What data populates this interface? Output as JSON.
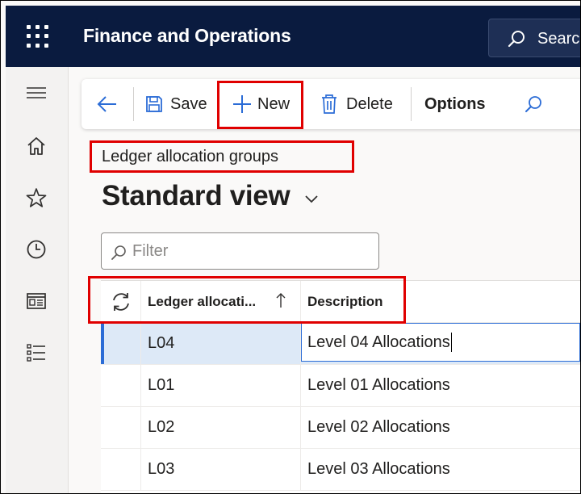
{
  "app": {
    "title": "Finance and Operations"
  },
  "search": {
    "label": "Search"
  },
  "actions": {
    "save": "Save",
    "new": "New",
    "delete": "Delete",
    "options": "Options"
  },
  "breadcrumb": "Ledger allocation groups",
  "view": {
    "title": "Standard view"
  },
  "filter": {
    "placeholder": "Filter"
  },
  "grid": {
    "columns": {
      "id": "Ledger allocati...",
      "description": "Description"
    },
    "rows": [
      {
        "id": "L04",
        "description": "Level 04 Allocations",
        "selected": true
      },
      {
        "id": "L01",
        "description": "Level 01 Allocations",
        "selected": false
      },
      {
        "id": "L02",
        "description": "Level 02 Allocations",
        "selected": false
      },
      {
        "id": "L03",
        "description": "Level 03 Allocations",
        "selected": false
      }
    ]
  },
  "colors": {
    "nav_bg": "#0a1b3f",
    "accent": "#2b6cd6",
    "highlight": "#e00000",
    "selected_row": "#dde9f7"
  },
  "icons": [
    "waffle-icon",
    "search-icon",
    "hamburger-icon",
    "home-icon",
    "star-icon",
    "clock-icon",
    "workspace-icon",
    "modules-icon",
    "back-arrow-icon",
    "save-icon",
    "plus-icon",
    "trash-icon",
    "refresh-icon",
    "sort-ascending-icon",
    "chevron-down-icon"
  ]
}
